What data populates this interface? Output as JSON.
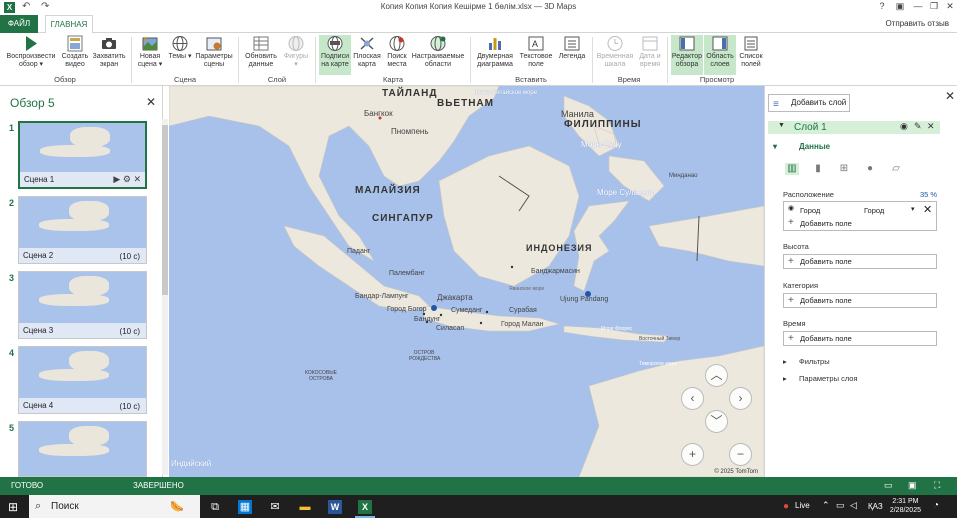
{
  "window": {
    "title": "Копия Копия Копия Кешірме 1 бөлім.xlsx — 3D Maps",
    "help_label": "?",
    "minimize_label": "—",
    "restore_label": "❐",
    "close_label": "✕"
  },
  "tabs": {
    "file": "ФАЙЛ",
    "home": "ГЛАВНАЯ",
    "share": "Отправить отзыв"
  },
  "ribbon": {
    "buttons": [
      {
        "label": "Воспроизвести обзор ▾",
        "icon": "play-icon"
      },
      {
        "label": "Создать видео",
        "icon": "video-icon"
      },
      {
        "label": "Захватить экран",
        "icon": "camera-icon"
      },
      {
        "label": "Новая сцена ▾",
        "icon": "new-scene-icon"
      },
      {
        "label": "Темы ▾",
        "icon": "globe-themes-icon"
      },
      {
        "label": "Параметры сцены",
        "icon": "scene-options-icon"
      },
      {
        "label": "Обновить данные",
        "icon": "refresh-icon"
      },
      {
        "label": "Фигуры ▾",
        "icon": "shapes-icon"
      },
      {
        "label": "Подписи на карте",
        "icon": "map-labels-icon"
      },
      {
        "label": "Плоская карта",
        "icon": "flat-map-icon"
      },
      {
        "label": "Поиск места",
        "icon": "find-location-icon"
      },
      {
        "label": "Настраиваемые области",
        "icon": "custom-regions-icon"
      },
      {
        "label": "Двумерная диаграмма",
        "icon": "2d-chart-icon"
      },
      {
        "label": "Текстовое поле",
        "icon": "text-box-icon"
      },
      {
        "label": "Легенда",
        "icon": "legend-icon"
      },
      {
        "label": "Временная шкала",
        "icon": "timeline-icon"
      },
      {
        "label": "Дата и время",
        "icon": "date-time-icon"
      },
      {
        "label": "Редактор обзора",
        "icon": "tour-editor-icon"
      },
      {
        "label": "Область слоев",
        "icon": "layer-pane-icon"
      },
      {
        "label": "Список полей",
        "icon": "field-list-icon"
      }
    ],
    "groups": [
      "Обзор",
      "Сцена",
      "Слой",
      "Карта",
      "Вставить",
      "Время",
      "Просмотр"
    ]
  },
  "left_panel": {
    "title": "Обзор 5",
    "close_label": "✕",
    "scenes": [
      {
        "num": "1",
        "label": "Сцена 1",
        "duration": ""
      },
      {
        "num": "2",
        "label": "Сцена 2",
        "duration": "(10 с)"
      },
      {
        "num": "3",
        "label": "Сцена 3",
        "duration": "(10 с)"
      },
      {
        "num": "4",
        "label": "Сцена 4",
        "duration": "(10 с)"
      },
      {
        "num": "5",
        "label": "",
        "duration": ""
      }
    ],
    "scene_tools": {
      "play": "▶",
      "settings": "⚙",
      "delete": "✕"
    }
  },
  "map": {
    "labels": {
      "thailand": "ТАЙЛАНД",
      "vietnam": "ВЬЕТНАМ",
      "bangkok": "Бангкок",
      "phnompenh": "Пномпень",
      "manila": "Манила",
      "philippines": "ФИЛИППИНЫ",
      "scs": "Южно-Китайское море",
      "sulu": "Море Сулу",
      "malaysia": "МАЛАЙЗИЯ",
      "singapore": "СИНГАПУР",
      "indonesia": "ИНДОНЕЗИЯ",
      "celebes": "Море Сулавеси",
      "padang": "Паданг",
      "palembang": "Палембанг",
      "bandarlampung": "Бандар-Лампунг",
      "jakarta": "Джакарта",
      "bogor": "Город Богор",
      "sumedang": "Сумеданг",
      "bandung": "Бандунг",
      "cilacap": "Силасап",
      "surabaya": "Сурабая",
      "malang": "Город Малан",
      "banjarmasin": "Банджармасин",
      "ujungpandang": "Ujung Pandang",
      "javasea": "Яванское море",
      "floressea": "Море Флорес",
      "banda": "Море Банда",
      "timor": "Восточный Тимор",
      "timorsea": "Тиморское море",
      "christmas": "ОСТРОВ РОЖДЕСТВА",
      "cocos": "КОКОСОВЫЕ ОСТРОВА",
      "indian": "Индийский",
      "negros": "Негрос",
      "mindanao": "Минданао"
    },
    "nav": {
      "up": "︿",
      "left": "‹",
      "right": "›",
      "down": "﹀",
      "zoom_in": "+",
      "zoom_out": "−"
    },
    "copyright": "© 2025 TomTom"
  },
  "right_panel": {
    "add_layer": "Добавить слой",
    "close_label": "✕",
    "layer_name": "Слой 1",
    "data_section": "Данные",
    "location_label": "Расположение",
    "location_pct": "35 %",
    "location_field": "Город",
    "location_type": "Город",
    "add_field": "Добавить поле",
    "height_label": "Высота",
    "category_label": "Категория",
    "time_label": "Время",
    "filters": "Фильтры",
    "layer_options": "Параметры слоя"
  },
  "status": {
    "ready": "ГОТОВО",
    "done": "ЗАВЕРШЕНО"
  },
  "taskbar": {
    "search": "Поиск",
    "live": "Live",
    "lang": "ҚАЗ",
    "time": "2:31 PM",
    "date": "2/28/2025"
  },
  "colors": {
    "accent": "#217346",
    "ocean": "#a8c1ea",
    "land": "#ece8dd"
  }
}
